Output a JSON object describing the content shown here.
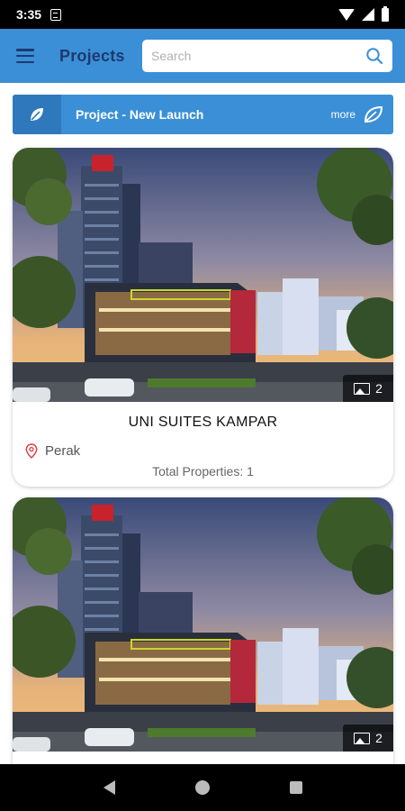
{
  "status_bar": {
    "time": "3:35",
    "icons": [
      "sim-icon",
      "wifi-icon",
      "signal-icon",
      "battery-icon"
    ]
  },
  "app_bar": {
    "title": "Projects",
    "search": {
      "placeholder": "Search",
      "value": ""
    },
    "accent_color": "#3b8fd6",
    "title_color": "#1d3a6e"
  },
  "banner": {
    "title": "Project - New Launch",
    "more_label": "more",
    "icon": "leaf-icon"
  },
  "projects": [
    {
      "name": "UNI SUITES KAMPAR",
      "location": "Perak",
      "total_properties": "Total Properties: 1",
      "photo_count": "2"
    },
    {
      "photo_count": "2"
    }
  ],
  "nav_bar": {
    "icons": [
      "back-icon",
      "home-icon",
      "recents-icon"
    ]
  }
}
